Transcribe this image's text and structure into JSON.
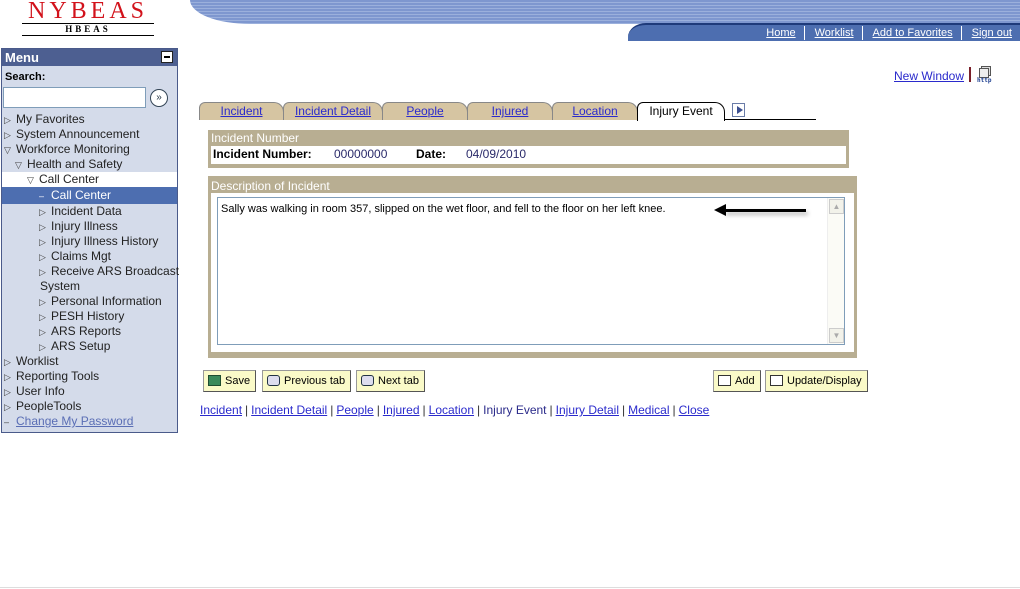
{
  "logo": {
    "main": "NYBEAS",
    "sub": "HBEAS"
  },
  "topnav": [
    {
      "label": "Home"
    },
    {
      "label": "Worklist"
    },
    {
      "label": "Add to Favorites"
    },
    {
      "label": "Sign out"
    }
  ],
  "menu": {
    "title": "Menu",
    "search_label": "Search:",
    "search_value": "",
    "items": [
      {
        "label": "My Favorites",
        "state": "collapsed",
        "level": 0
      },
      {
        "label": "System Announcement",
        "state": "collapsed",
        "level": 0
      },
      {
        "label": "Workforce Monitoring",
        "state": "expanded",
        "level": 0
      },
      {
        "label": "Health and Safety",
        "state": "expanded",
        "level": 1
      },
      {
        "label": "Call Center",
        "state": "expanded",
        "level": 2
      },
      {
        "label": "Call Center",
        "state": "leaf-selected",
        "level": 3
      },
      {
        "label": "Incident Data",
        "state": "collapsed",
        "level": 3
      },
      {
        "label": "Injury Illness",
        "state": "collapsed",
        "level": 3
      },
      {
        "label": "Injury Illness History",
        "state": "collapsed",
        "level": 3
      },
      {
        "label": "Claims Mgt",
        "state": "collapsed",
        "level": 3
      },
      {
        "label": "Receive ARS Broadcast",
        "label_line2": "System",
        "state": "collapsed",
        "level": 3
      },
      {
        "label": "Personal Information",
        "state": "collapsed",
        "level": 3
      },
      {
        "label": "PESH History",
        "state": "collapsed",
        "level": 3
      },
      {
        "label": "ARS Reports",
        "state": "collapsed",
        "level": 3
      },
      {
        "label": "ARS Setup",
        "state": "collapsed",
        "level": 3
      },
      {
        "label": "Worklist",
        "state": "collapsed",
        "level": 0
      },
      {
        "label": "Reporting Tools",
        "state": "collapsed",
        "level": 0
      },
      {
        "label": "User Info",
        "state": "collapsed",
        "level": 0
      },
      {
        "label": "PeopleTools",
        "state": "collapsed",
        "level": 0
      },
      {
        "label": "Change My Password",
        "state": "link",
        "level": 0
      }
    ]
  },
  "new_window": {
    "label": "New Window",
    "icon_text": "http"
  },
  "tabs": [
    {
      "label": "Incident",
      "active": false
    },
    {
      "label": "Incident Detail",
      "active": false
    },
    {
      "label": "People",
      "active": false
    },
    {
      "label": "Injured",
      "active": false
    },
    {
      "label": "Location",
      "active": false
    },
    {
      "label": "Injury Event",
      "active": true
    }
  ],
  "incident_group": {
    "title": "Incident Number",
    "number_label": "Incident Number:",
    "number_value": "00000000",
    "date_label": "Date:",
    "date_value": "04/09/2010"
  },
  "description_group": {
    "title": "Description of Incident",
    "text": "Sally was walking in room 357, slipped on the wet floor, and fell to the floor on her left knee."
  },
  "buttons": {
    "save": "Save",
    "previous_tab": "Previous tab",
    "next_tab": "Next tab",
    "add": "Add",
    "update_display": "Update/Display"
  },
  "bottom_links": [
    {
      "label": "Incident",
      "current": false
    },
    {
      "label": "Incident Detail",
      "current": false
    },
    {
      "label": "People",
      "current": false
    },
    {
      "label": "Injured",
      "current": false
    },
    {
      "label": "Location",
      "current": false
    },
    {
      "label": "Injury Event",
      "current": true
    },
    {
      "label": "Injury Detail",
      "current": false
    },
    {
      "label": "Medical",
      "current": false
    },
    {
      "label": "Close",
      "current": false
    }
  ]
}
